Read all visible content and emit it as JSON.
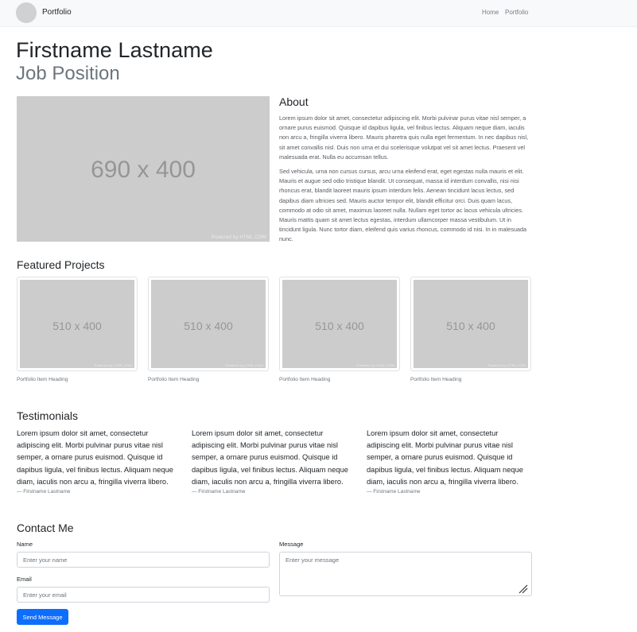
{
  "navbar": {
    "logo_text": "",
    "brand": "Portfolio",
    "links": [
      "Home",
      "Portfolio"
    ]
  },
  "hero": {
    "name": "Firstname Lastname",
    "position": "Job Position"
  },
  "about": {
    "image_text": "690 x 400",
    "image_powered": "Powered by HTML.COM",
    "title": "About",
    "paragraphs": [
      "Lorem ipsum dolor sit amet, consectetur adipiscing elit. Morbi pulvinar purus vitae nisl semper, a ornare purus euismod. Quisque id dapibus ligula, vel finibus lectus. Aliquam neque diam, iaculis non arcu a, fringilla viverra libero. Mauris pharetra quis nulla eget fermentum. In nec dapibus nisl, sit amet convallis nisl. Duis non urna et dui scelerisque volutpat vel sit amet lectus. Praesent vel malesuada erat. Nulla eu accumsan tellus.",
      "Sed vehicula, urna non cursus cursus, arcu urna eleifend erat, eget egestas nulla mauris et elit. Mauris et augue sed odio tristique blandit. Ut consequat, massa id interdum convallis, nisi nisi rhoncus erat, blandit laoreet mauris ipsum interdum felis. Aenean tincidunt lacus lectus, sed dapibus diam ultricies sed. Mauris auctor tempor elit, blandit efficitur orci. Duis quam lacus, commodo at odio sit amet, maximus laoreet nulla. Nullam eget tortor ac lacus vehicula ultricies. Mauris mattis quam sit amet lectus egestas, interdum ullamcorper massa vestibulum. Ut in tincidunt ligula. Nunc tortor diam, eleifend quis varius rhoncus, commodo id nisi. In in malesuada nunc."
    ]
  },
  "featured": {
    "title": "Featured Projects",
    "items": [
      {
        "image_text": "510 x 400",
        "powered": "Powered by HTML.COM",
        "caption": "Portfolio Item Heading"
      },
      {
        "image_text": "510 x 400",
        "powered": "Powered by HTML.COM",
        "caption": "Portfolio Item Heading"
      },
      {
        "image_text": "510 x 400",
        "powered": "Powered by HTML.COM",
        "caption": "Portfolio Item Heading"
      },
      {
        "image_text": "510 x 400",
        "powered": "Powered by HTML.COM",
        "caption": "Portfolio Item Heading"
      }
    ]
  },
  "testimonials": {
    "title": "Testimonials",
    "items": [
      {
        "quote": "Lorem ipsum dolor sit amet, consectetur adipiscing elit. Morbi pulvinar purus vitae nisl semper, a ornare purus euismod. Quisque id dapibus ligula, vel finibus lectus. Aliquam neque diam, iaculis non arcu a, fringilla viverra libero.",
        "author": "— Firstname Lastname"
      },
      {
        "quote": "Lorem ipsum dolor sit amet, consectetur adipiscing elit. Morbi pulvinar purus vitae nisl semper, a ornare purus euismod. Quisque id dapibus ligula, vel finibus lectus. Aliquam neque diam, iaculis non arcu a, fringilla viverra libero.",
        "author": "— Firstname Lastname"
      },
      {
        "quote": "Lorem ipsum dolor sit amet, consectetur adipiscing elit. Morbi pulvinar purus vitae nisl semper, a ornare purus euismod. Quisque id dapibus ligula, vel finibus lectus. Aliquam neque diam, iaculis non arcu a, fringilla viverra libero.",
        "author": "— Firstname Lastname"
      }
    ]
  },
  "contact": {
    "title": "Contact Me",
    "name_label": "Name",
    "name_placeholder": "Enter your name",
    "name_value": "",
    "email_label": "Email",
    "email_placeholder": "Enter your email",
    "email_value": "",
    "message_label": "Message",
    "message_placeholder": "Enter your message",
    "message_value": "",
    "submit_label": "Send Message"
  },
  "colors": {
    "navbar_bg": "#f8f9fa",
    "placeholder_bg": "#cccccc",
    "button_primary": "#0d6efd",
    "muted_text": "#6c757d"
  }
}
